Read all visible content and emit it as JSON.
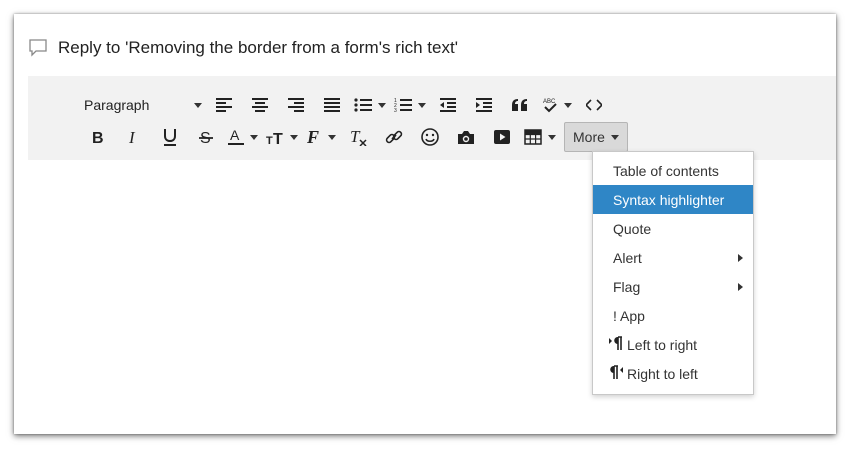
{
  "reply": {
    "title": "Reply to 'Removing the border from a form's rich text'"
  },
  "toolbar": {
    "format_select": "Paragraph",
    "more_label": "More",
    "row1_icons": [
      "align-left-icon",
      "align-center-icon",
      "align-right-icon",
      "align-justify-icon",
      "bullet-list-icon",
      "numbered-list-icon",
      "outdent-icon",
      "indent-icon",
      "blockquote-icon",
      "spellcheck-icon",
      "source-code-icon"
    ],
    "row2_icons": [
      "bold-icon",
      "italic-icon",
      "underline-icon",
      "strikethrough-icon",
      "text-color-icon",
      "font-size-icon",
      "font-family-icon",
      "clear-format-icon",
      "link-icon",
      "emoji-icon",
      "image-icon",
      "video-icon",
      "table-icon"
    ]
  },
  "menu": {
    "items": [
      {
        "label": "Table of contents"
      },
      {
        "label": "Syntax highlighter",
        "active": true
      },
      {
        "label": "Quote"
      },
      {
        "label": "Alert",
        "submenu": true
      },
      {
        "label": "Flag",
        "submenu": true
      },
      {
        "label": "! App"
      },
      {
        "label": "Left to right",
        "icon": "ltr-icon"
      },
      {
        "label": "Right to left",
        "icon": "rtl-icon"
      }
    ]
  },
  "colors": {
    "accent": "#2f86c6",
    "toolbar_bg": "#f2f2f2",
    "more_bg": "#d9d9d9"
  }
}
